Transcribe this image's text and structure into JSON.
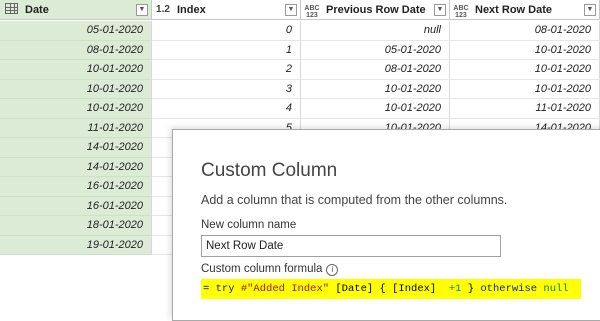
{
  "columns": [
    {
      "name": "Date",
      "type_icon": "table-icon"
    },
    {
      "name": "Index",
      "type_icon": "1.2"
    },
    {
      "name": "Previous Row Date",
      "type_icon": "ABC 123"
    },
    {
      "name": "Next Row Date",
      "type_icon": "ABC 123"
    }
  ],
  "rows": [
    [
      "05-01-2020",
      "0",
      "null",
      "08-01-2020"
    ],
    [
      "08-01-2020",
      "1",
      "05-01-2020",
      "10-01-2020"
    ],
    [
      "10-01-2020",
      "2",
      "08-01-2020",
      "10-01-2020"
    ],
    [
      "10-01-2020",
      "3",
      "10-01-2020",
      "10-01-2020"
    ],
    [
      "10-01-2020",
      "4",
      "10-01-2020",
      "11-01-2020"
    ],
    [
      "11-01-2020",
      "5",
      "10-01-2020",
      "14-01-2020"
    ],
    [
      "14-01-2020",
      "",
      "",
      ""
    ],
    [
      "14-01-2020",
      "",
      "",
      ""
    ],
    [
      "16-01-2020",
      "",
      "",
      ""
    ],
    [
      "16-01-2020",
      "",
      "",
      ""
    ],
    [
      "18-01-2020",
      "",
      "",
      ""
    ],
    [
      "19-01-2020",
      "",
      "",
      ""
    ]
  ],
  "dialog": {
    "title": "Custom Column",
    "description": "Add a column that is computed from the other columns.",
    "name_label": "New column name",
    "name_value": "Next Row Date",
    "formula_label": "Custom column formula",
    "formula": {
      "prefix": "= ",
      "try": "try",
      "string": "#\"Added Index\"",
      "field1": "[Date]",
      "brace_open": "{",
      "field2": "[Index]",
      "plus": "+1",
      "brace_close": "}",
      "otherwise": "otherwise",
      "null": "null"
    }
  },
  "colors": {
    "selected_column": "#dcebd6",
    "formula_highlight": "#ffff00"
  }
}
